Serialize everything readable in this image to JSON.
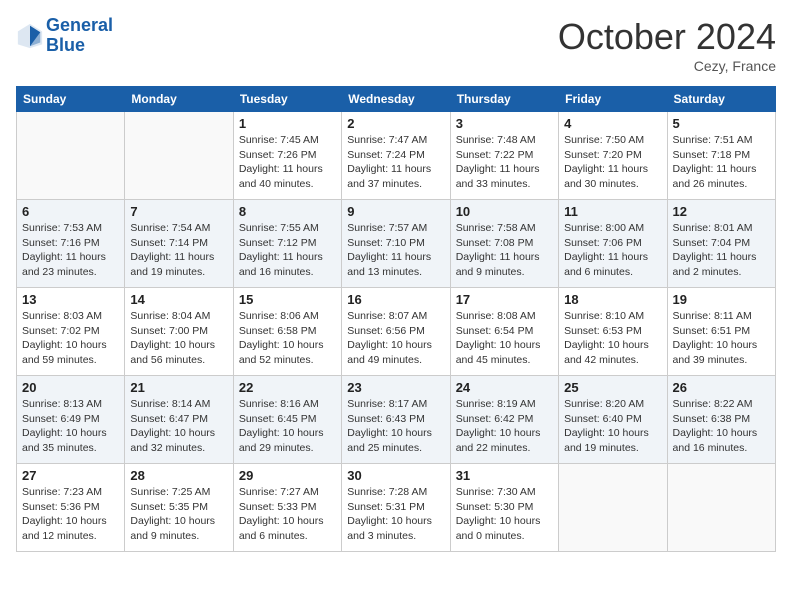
{
  "header": {
    "logo_line1": "General",
    "logo_line2": "Blue",
    "month_title": "October 2024",
    "location": "Cezy, France"
  },
  "days_of_week": [
    "Sunday",
    "Monday",
    "Tuesday",
    "Wednesday",
    "Thursday",
    "Friday",
    "Saturday"
  ],
  "weeks": [
    [
      {
        "day": "",
        "info": ""
      },
      {
        "day": "",
        "info": ""
      },
      {
        "day": "1",
        "info": "Sunrise: 7:45 AM\nSunset: 7:26 PM\nDaylight: 11 hours and 40 minutes."
      },
      {
        "day": "2",
        "info": "Sunrise: 7:47 AM\nSunset: 7:24 PM\nDaylight: 11 hours and 37 minutes."
      },
      {
        "day": "3",
        "info": "Sunrise: 7:48 AM\nSunset: 7:22 PM\nDaylight: 11 hours and 33 minutes."
      },
      {
        "day": "4",
        "info": "Sunrise: 7:50 AM\nSunset: 7:20 PM\nDaylight: 11 hours and 30 minutes."
      },
      {
        "day": "5",
        "info": "Sunrise: 7:51 AM\nSunset: 7:18 PM\nDaylight: 11 hours and 26 minutes."
      }
    ],
    [
      {
        "day": "6",
        "info": "Sunrise: 7:53 AM\nSunset: 7:16 PM\nDaylight: 11 hours and 23 minutes."
      },
      {
        "day": "7",
        "info": "Sunrise: 7:54 AM\nSunset: 7:14 PM\nDaylight: 11 hours and 19 minutes."
      },
      {
        "day": "8",
        "info": "Sunrise: 7:55 AM\nSunset: 7:12 PM\nDaylight: 11 hours and 16 minutes."
      },
      {
        "day": "9",
        "info": "Sunrise: 7:57 AM\nSunset: 7:10 PM\nDaylight: 11 hours and 13 minutes."
      },
      {
        "day": "10",
        "info": "Sunrise: 7:58 AM\nSunset: 7:08 PM\nDaylight: 11 hours and 9 minutes."
      },
      {
        "day": "11",
        "info": "Sunrise: 8:00 AM\nSunset: 7:06 PM\nDaylight: 11 hours and 6 minutes."
      },
      {
        "day": "12",
        "info": "Sunrise: 8:01 AM\nSunset: 7:04 PM\nDaylight: 11 hours and 2 minutes."
      }
    ],
    [
      {
        "day": "13",
        "info": "Sunrise: 8:03 AM\nSunset: 7:02 PM\nDaylight: 10 hours and 59 minutes."
      },
      {
        "day": "14",
        "info": "Sunrise: 8:04 AM\nSunset: 7:00 PM\nDaylight: 10 hours and 56 minutes."
      },
      {
        "day": "15",
        "info": "Sunrise: 8:06 AM\nSunset: 6:58 PM\nDaylight: 10 hours and 52 minutes."
      },
      {
        "day": "16",
        "info": "Sunrise: 8:07 AM\nSunset: 6:56 PM\nDaylight: 10 hours and 49 minutes."
      },
      {
        "day": "17",
        "info": "Sunrise: 8:08 AM\nSunset: 6:54 PM\nDaylight: 10 hours and 45 minutes."
      },
      {
        "day": "18",
        "info": "Sunrise: 8:10 AM\nSunset: 6:53 PM\nDaylight: 10 hours and 42 minutes."
      },
      {
        "day": "19",
        "info": "Sunrise: 8:11 AM\nSunset: 6:51 PM\nDaylight: 10 hours and 39 minutes."
      }
    ],
    [
      {
        "day": "20",
        "info": "Sunrise: 8:13 AM\nSunset: 6:49 PM\nDaylight: 10 hours and 35 minutes."
      },
      {
        "day": "21",
        "info": "Sunrise: 8:14 AM\nSunset: 6:47 PM\nDaylight: 10 hours and 32 minutes."
      },
      {
        "day": "22",
        "info": "Sunrise: 8:16 AM\nSunset: 6:45 PM\nDaylight: 10 hours and 29 minutes."
      },
      {
        "day": "23",
        "info": "Sunrise: 8:17 AM\nSunset: 6:43 PM\nDaylight: 10 hours and 25 minutes."
      },
      {
        "day": "24",
        "info": "Sunrise: 8:19 AM\nSunset: 6:42 PM\nDaylight: 10 hours and 22 minutes."
      },
      {
        "day": "25",
        "info": "Sunrise: 8:20 AM\nSunset: 6:40 PM\nDaylight: 10 hours and 19 minutes."
      },
      {
        "day": "26",
        "info": "Sunrise: 8:22 AM\nSunset: 6:38 PM\nDaylight: 10 hours and 16 minutes."
      }
    ],
    [
      {
        "day": "27",
        "info": "Sunrise: 7:23 AM\nSunset: 5:36 PM\nDaylight: 10 hours and 12 minutes."
      },
      {
        "day": "28",
        "info": "Sunrise: 7:25 AM\nSunset: 5:35 PM\nDaylight: 10 hours and 9 minutes."
      },
      {
        "day": "29",
        "info": "Sunrise: 7:27 AM\nSunset: 5:33 PM\nDaylight: 10 hours and 6 minutes."
      },
      {
        "day": "30",
        "info": "Sunrise: 7:28 AM\nSunset: 5:31 PM\nDaylight: 10 hours and 3 minutes."
      },
      {
        "day": "31",
        "info": "Sunrise: 7:30 AM\nSunset: 5:30 PM\nDaylight: 10 hours and 0 minutes."
      },
      {
        "day": "",
        "info": ""
      },
      {
        "day": "",
        "info": ""
      }
    ]
  ]
}
